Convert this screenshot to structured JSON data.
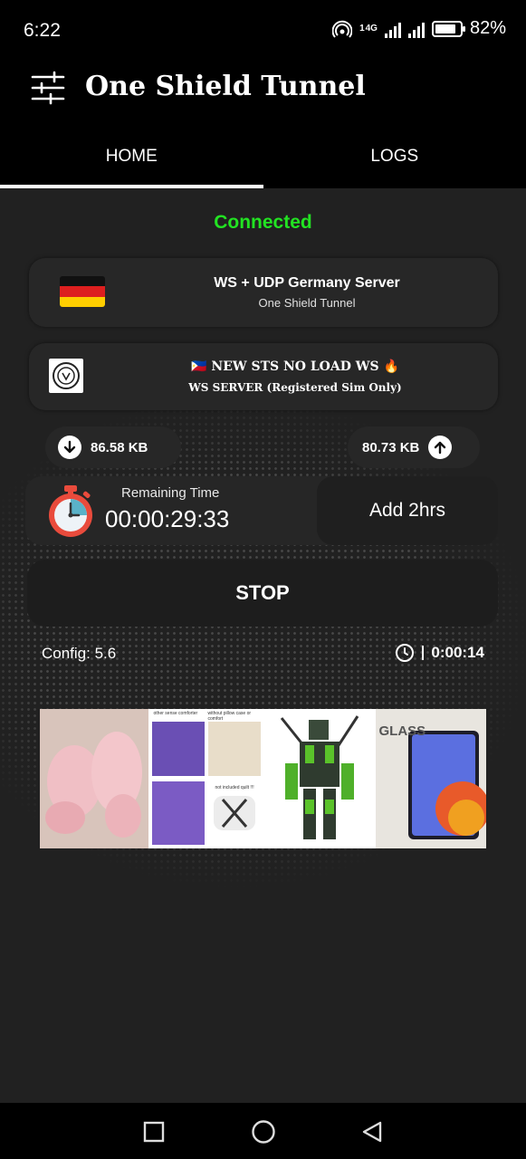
{
  "status_bar": {
    "time": "6:22",
    "network_label": "4G",
    "sim_slot": "1",
    "battery": "82%"
  },
  "app": {
    "title": "One Shield Tunnel",
    "menu_icon": "sliders-icon"
  },
  "tabs": [
    {
      "label": "HOME",
      "active": true
    },
    {
      "label": "LOGS",
      "active": false
    }
  ],
  "connection": {
    "status": "Connected",
    "status_color": "#22e322"
  },
  "server": {
    "name": "WS + UDP Germany Server",
    "subtitle": "One Shield Tunnel",
    "flag_icon": "germany-flag-icon"
  },
  "payload": {
    "line1": "🇵🇭 NEW STS NO LOAD  WS 🔥",
    "line2": "WS SERVER (Registered Sim Only)",
    "logo_icon": "payload-logo-icon"
  },
  "traffic": {
    "download": "86.58 KB",
    "upload": "80.73 KB"
  },
  "timer": {
    "label": "Remaining Time",
    "value": "00:00:29:33",
    "add_button": "Add 2hrs"
  },
  "stop_button": "STOP",
  "footer_info": {
    "config": "Config: 5.6",
    "elapsed": "0:00:14"
  },
  "ad_banner": {
    "items": [
      "slippers-ad-image",
      "bedding-ad-image",
      "robot-toy-ad-image",
      "tablet-glass-ad-image"
    ],
    "texts": [
      "other sense comforter",
      "without pillow case or comfort",
      "not included quilt !!!",
      "GLASS"
    ]
  },
  "nav_bar": {
    "buttons": [
      "recent-apps-button",
      "home-button",
      "back-button"
    ]
  }
}
